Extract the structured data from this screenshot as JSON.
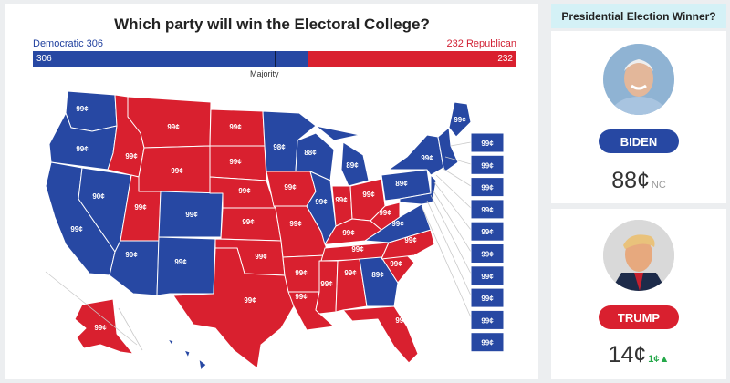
{
  "main": {
    "title": "Which party will win the Electoral College?",
    "dem_legend": "Democratic 306",
    "rep_legend": "232 Republican",
    "dem_value": "306",
    "rep_value": "232",
    "majority_label": "Majority"
  },
  "electoral": {
    "dem": 306,
    "rep": 232,
    "total": 538
  },
  "colors": {
    "democratic": "#2748a3",
    "republican": "#d9202f",
    "header_bg": "#d4f1f6",
    "change_up": "#25a84a"
  },
  "states": [
    {
      "name": "Washington",
      "party": "D",
      "price": "99¢"
    },
    {
      "name": "Oregon",
      "party": "D",
      "price": "99¢"
    },
    {
      "name": "California",
      "party": "D",
      "price": "99¢"
    },
    {
      "name": "Nevada",
      "party": "D",
      "price": "90¢"
    },
    {
      "name": "Idaho",
      "party": "R",
      "price": "99¢"
    },
    {
      "name": "Montana",
      "party": "R",
      "price": "99¢"
    },
    {
      "name": "Wyoming",
      "party": "R",
      "price": "99¢"
    },
    {
      "name": "Utah",
      "party": "R",
      "price": "99¢"
    },
    {
      "name": "Colorado",
      "party": "D",
      "price": "99¢"
    },
    {
      "name": "Arizona",
      "party": "D",
      "price": "90¢"
    },
    {
      "name": "New Mexico",
      "party": "D",
      "price": "99¢"
    },
    {
      "name": "North Dakota",
      "party": "R",
      "price": "99¢"
    },
    {
      "name": "South Dakota",
      "party": "R",
      "price": "99¢"
    },
    {
      "name": "Nebraska",
      "party": "R",
      "price": "99¢"
    },
    {
      "name": "Kansas",
      "party": "R",
      "price": "99¢"
    },
    {
      "name": "Oklahoma",
      "party": "R",
      "price": "99¢"
    },
    {
      "name": "Texas",
      "party": "R",
      "price": "99¢"
    },
    {
      "name": "Minnesota",
      "party": "D",
      "price": "98¢"
    },
    {
      "name": "Iowa",
      "party": "R",
      "price": "99¢"
    },
    {
      "name": "Missouri",
      "party": "R",
      "price": "99¢"
    },
    {
      "name": "Arkansas",
      "party": "R",
      "price": "99¢"
    },
    {
      "name": "Louisiana",
      "party": "R",
      "price": "99¢"
    },
    {
      "name": "Wisconsin",
      "party": "D",
      "price": "88¢"
    },
    {
      "name": "Illinois",
      "party": "D",
      "price": "99¢"
    },
    {
      "name": "Michigan",
      "party": "D",
      "price": "89¢"
    },
    {
      "name": "Indiana",
      "party": "R",
      "price": "99¢"
    },
    {
      "name": "Ohio",
      "party": "R",
      "price": "99¢"
    },
    {
      "name": "Kentucky",
      "party": "R",
      "price": "99¢"
    },
    {
      "name": "Tennessee",
      "party": "R",
      "price": "99¢"
    },
    {
      "name": "Mississippi",
      "party": "R",
      "price": "99¢"
    },
    {
      "name": "Alabama",
      "party": "R",
      "price": "99¢"
    },
    {
      "name": "Georgia",
      "party": "D",
      "price": "89¢"
    },
    {
      "name": "Florida",
      "party": "R",
      "price": "99¢"
    },
    {
      "name": "South Carolina",
      "party": "R",
      "price": "99¢"
    },
    {
      "name": "North Carolina",
      "party": "R",
      "price": "99¢"
    },
    {
      "name": "Virginia",
      "party": "D",
      "price": "99¢"
    },
    {
      "name": "West Virginia",
      "party": "R",
      "price": "99¢"
    },
    {
      "name": "Pennsylvania",
      "party": "D",
      "price": "89¢"
    },
    {
      "name": "New York",
      "party": "D",
      "price": "99¢"
    },
    {
      "name": "Maine",
      "party": "D",
      "price": "99¢"
    },
    {
      "name": "Alaska",
      "party": "R",
      "price": "99¢"
    },
    {
      "name": "Hawaii",
      "party": "D",
      "price": ""
    }
  ],
  "east_squares": [
    "99¢",
    "99¢",
    "99¢",
    "99¢",
    "99¢",
    "99¢",
    "99¢",
    "99¢",
    "99¢",
    "99¢"
  ],
  "sidebar": {
    "header": "Presidential Election Winner?",
    "candidates": [
      {
        "name": "BIDEN",
        "party": "D",
        "price": "88¢",
        "change": "NC",
        "direction": "none"
      },
      {
        "name": "TRUMP",
        "party": "R",
        "price": "14¢",
        "change": "1¢",
        "direction": "up"
      }
    ]
  }
}
